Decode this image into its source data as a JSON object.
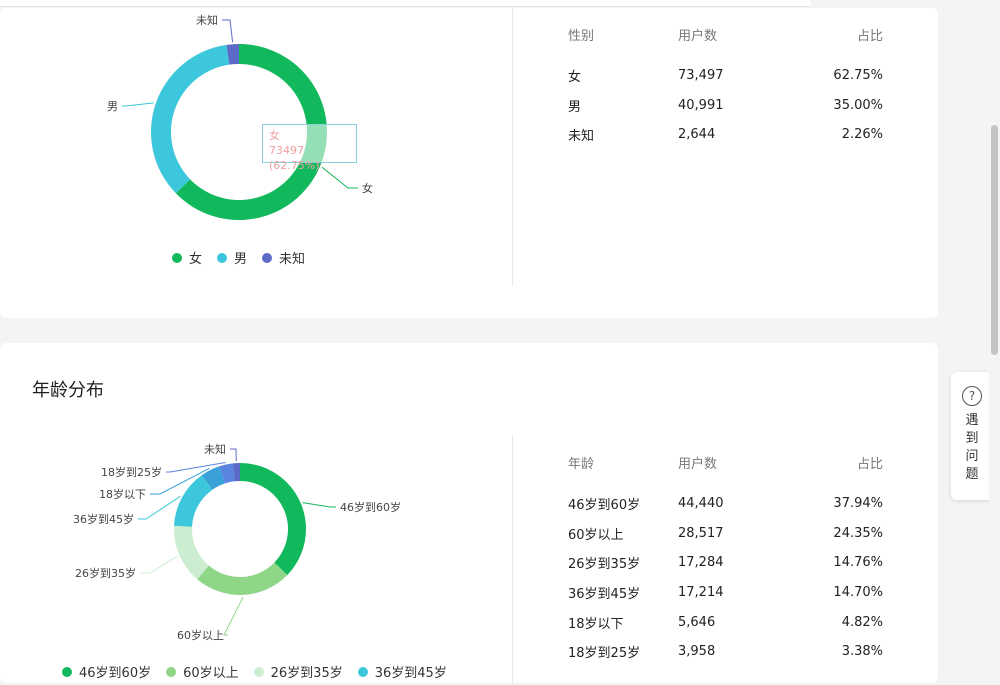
{
  "gender": {
    "chart_data": {
      "type": "pie",
      "categories": [
        "女",
        "男",
        "未知"
      ],
      "values": [
        73497,
        40991,
        2644
      ],
      "colors": [
        "#12b85c",
        "#3dc7dc",
        "#5b6ac7"
      ]
    },
    "slice_labels": [
      "女",
      "男",
      "未知"
    ],
    "tooltip": {
      "name": "女",
      "value": "73497 (62.75%)"
    },
    "legend": [
      {
        "label": "女",
        "color": "#12b85c"
      },
      {
        "label": "男",
        "color": "#3dc7dc"
      },
      {
        "label": "未知",
        "color": "#5b6ac7"
      }
    ],
    "table": {
      "headers": [
        "性别",
        "用户数",
        "占比"
      ],
      "rows": [
        [
          "女",
          "73,497",
          "62.75%"
        ],
        [
          "男",
          "40,991",
          "35.00%"
        ],
        [
          "未知",
          "2,644",
          "2.26%"
        ]
      ]
    }
  },
  "age": {
    "title": "年龄分布",
    "chart_data": {
      "type": "pie",
      "categories": [
        "46岁到60岁",
        "60岁以上",
        "26岁到35岁",
        "36岁到45岁",
        "18岁以下",
        "18岁到25岁",
        "未知"
      ],
      "values": [
        44440,
        28517,
        17284,
        17214,
        5646,
        3958,
        2073
      ],
      "colors": [
        "#12b85c",
        "#8fd688",
        "#cdedd0",
        "#3dc7dc",
        "#3aa0d8",
        "#5a83e0",
        "#5b6ac7"
      ]
    },
    "slice_labels": [
      "46岁到60岁",
      "60岁以上",
      "26岁到35岁",
      "36岁到45岁",
      "18岁以下",
      "18岁到25岁",
      "未知"
    ],
    "legend": [
      {
        "label": "46岁到60岁",
        "color": "#12b85c"
      },
      {
        "label": "60岁以上",
        "color": "#8fd688"
      },
      {
        "label": "26岁到35岁",
        "color": "#cdedd0"
      },
      {
        "label": "36岁到45岁",
        "color": "#3dc7dc"
      }
    ],
    "table": {
      "headers": [
        "年龄",
        "用户数",
        "占比"
      ],
      "rows": [
        [
          "46岁到60岁",
          "44,440",
          "37.94%"
        ],
        [
          "60岁以上",
          "28,517",
          "24.35%"
        ],
        [
          "26岁到35岁",
          "17,284",
          "14.76%"
        ],
        [
          "36岁到45岁",
          "17,214",
          "14.70%"
        ],
        [
          "18岁以下",
          "5,646",
          "4.82%"
        ],
        [
          "18岁到25岁",
          "3,958",
          "3.38%"
        ]
      ]
    }
  },
  "help": {
    "icon": "question-circle-icon",
    "icon_glyph": "?",
    "label": "遇到问题"
  }
}
